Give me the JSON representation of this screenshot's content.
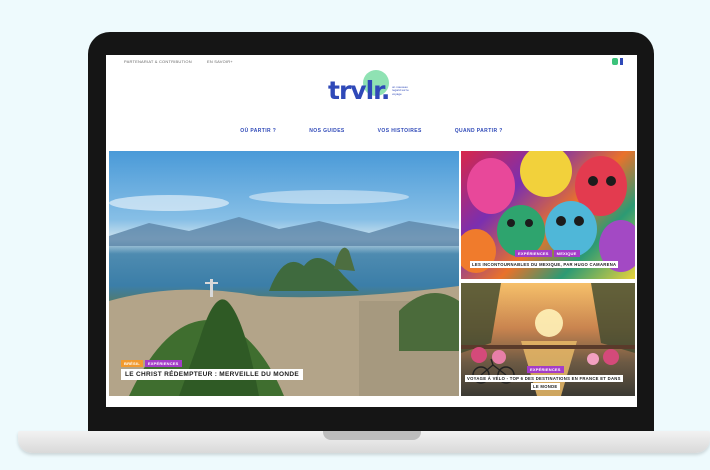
{
  "topbar": {
    "link1": "PARTENARIAT & CONTRIBUTION",
    "link2": "EN SAVOIR+"
  },
  "logo": {
    "text": "trvlr.",
    "tagline": "un nouveau regard sur le voyage"
  },
  "nav": [
    "OÙ PARTIR ?",
    "NOS GUIDES",
    "VOS HISTOIRES",
    "QUAND PARTIR ?"
  ],
  "hero": {
    "tags": [
      "BRÉSIL",
      "EXPÉRIENCES"
    ],
    "title": "LE CHRIST RÉDEMPTEUR : MERVEILLE DU MONDE"
  },
  "card1": {
    "tags": [
      "EXPÉRIENCES",
      "MEXIQUE"
    ],
    "title": "LES INCONTOURNABLES DU MEXIQUE, PAR HUGO CAMARENA"
  },
  "card2": {
    "tags": [
      "EXPÉRIENCES"
    ],
    "title_line1": "VOYAGE À VÉLO - TOP 6 DES DESTINATIONS EN FRANCE ET DANS",
    "title_line2": "LE MONDE"
  },
  "colors": {
    "brand_blue": "#2f49b8",
    "tag_orange": "#f29a2e",
    "tag_purple": "#a43cc8",
    "logo_green": "#8fe2b3"
  }
}
